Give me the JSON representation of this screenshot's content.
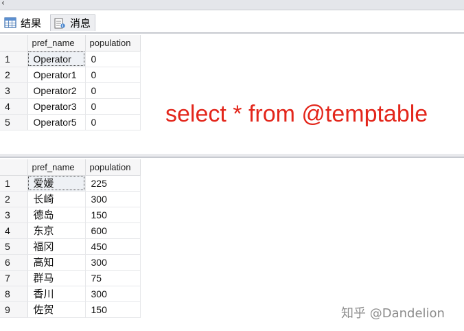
{
  "tabs": [
    {
      "label": "结果",
      "icon": "results-grid-icon",
      "active": true
    },
    {
      "label": "消息",
      "icon": "messages-icon",
      "active": false
    }
  ],
  "grid1": {
    "columns": [
      "pref_name",
      "population"
    ],
    "rows": [
      [
        "1",
        "Operator",
        "0"
      ],
      [
        "2",
        "Operator1",
        "0"
      ],
      [
        "3",
        "Operator2",
        "0"
      ],
      [
        "4",
        "Operator3",
        "0"
      ],
      [
        "5",
        "Operator5",
        "0"
      ]
    ]
  },
  "grid2": {
    "columns": [
      "pref_name",
      "population"
    ],
    "rows": [
      [
        "1",
        "爱媛",
        "225"
      ],
      [
        "2",
        "长崎",
        "300"
      ],
      [
        "3",
        "德岛",
        "150"
      ],
      [
        "4",
        "东京",
        "600"
      ],
      [
        "5",
        "福冈",
        "450"
      ],
      [
        "6",
        "高知",
        "300"
      ],
      [
        "7",
        "群马",
        "75"
      ],
      [
        "8",
        "香川",
        "300"
      ],
      [
        "9",
        "佐贺",
        "150"
      ]
    ]
  },
  "annotation": "select * from @temptable",
  "watermark": "知乎 @Dandelion",
  "colors": {
    "annotation": "#e3261b",
    "watermark": "#8c8c8c"
  }
}
